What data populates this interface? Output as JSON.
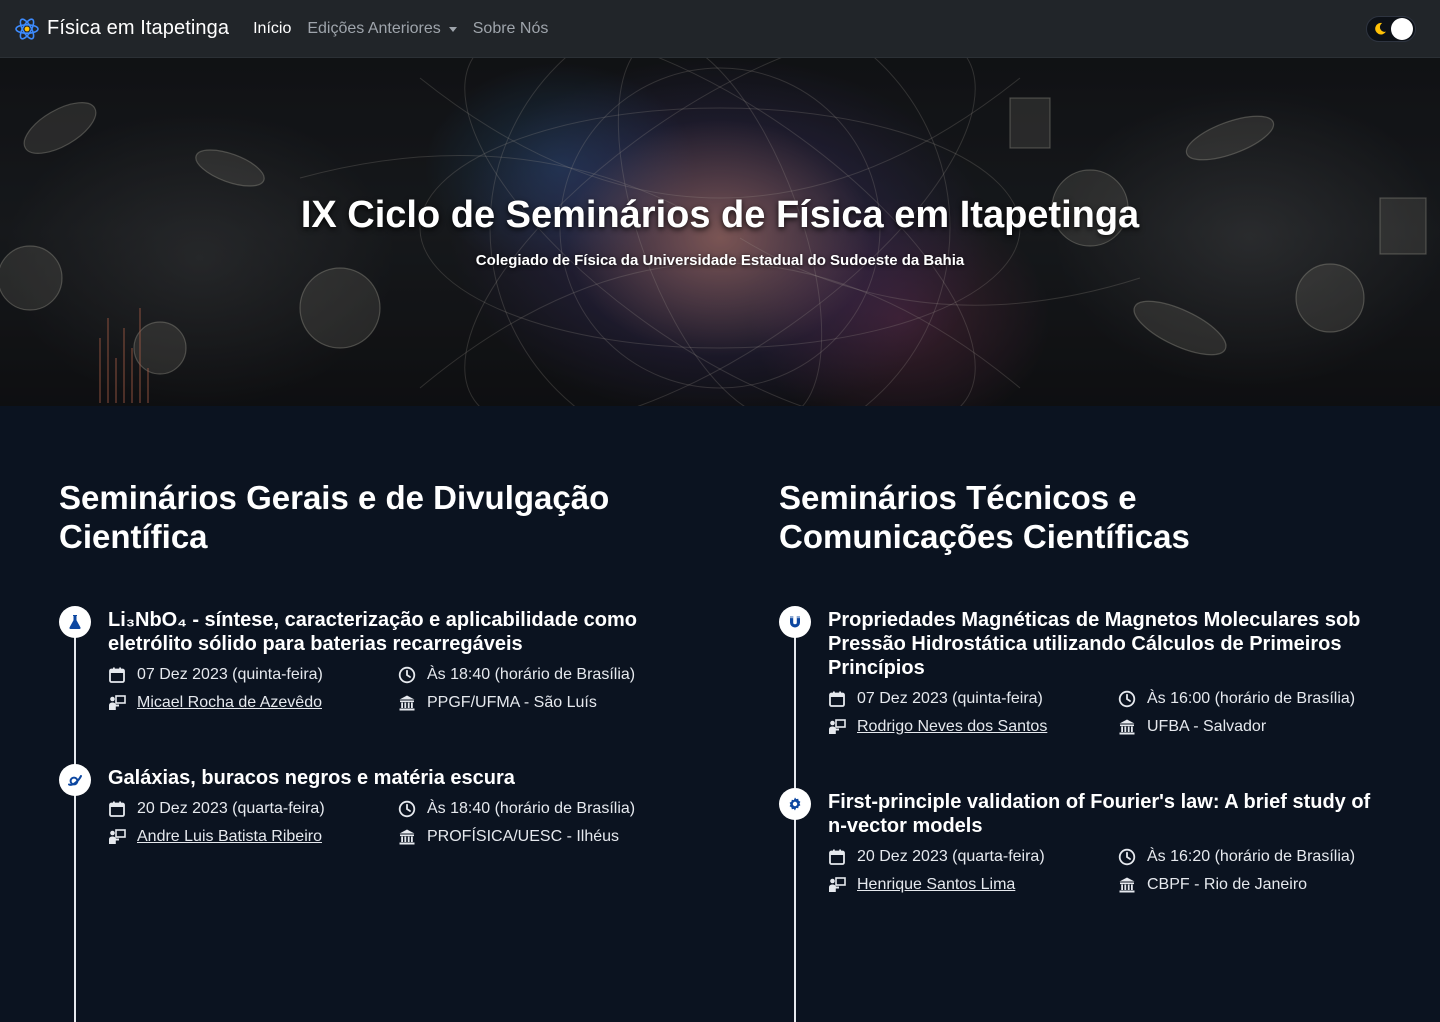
{
  "navbar": {
    "brand": "Física em Itapetinga",
    "links": [
      "Início",
      "Edições Anteriores",
      "Sobre Nós"
    ]
  },
  "hero": {
    "title": "IX Ciclo de Seminários de Física em Itapetinga",
    "subtitle": "Colegiado de Física da Universidade Estadual do Sudoeste da Bahia"
  },
  "general": {
    "heading": "Seminários Gerais e de Divulgação Científica",
    "items": [
      {
        "icon": "flask-icon",
        "title": "Li₃NbO₄ - síntese, caracterização e aplicabilidade como eletrólito sólido para baterias recarregáveis",
        "date": "07 Dez 2023 (quinta-feira)",
        "time": "Às 18:40 (horário de Brasília)",
        "speaker": "Micael Rocha de Azevêdo",
        "institution": "PPGF/UFMA - São Luís"
      },
      {
        "icon": "galaxy-icon",
        "title": "Galáxias, buracos negros e matéria escura",
        "date": "20 Dez 2023 (quarta-feira)",
        "time": "Às 18:40 (horário de Brasília)",
        "speaker": "Andre Luis Batista Ribeiro",
        "institution": "PROFÍSICA/UESC - Ilhéus"
      }
    ]
  },
  "technical": {
    "heading": "Seminários Técnicos e Comunicações Científicas",
    "items": [
      {
        "icon": "magnet-icon",
        "title": "Propriedades Magnéticas de Magnetos Moleculares sob Pressão Hidrostática utilizando Cálculos de Primeiros Princípios",
        "date": "07 Dez 2023 (quinta-feira)",
        "time": "Às 16:00 (horário de Brasília)",
        "speaker": "Rodrigo Neves dos Santos",
        "institution": "UFBA - Salvador"
      },
      {
        "icon": "gear-icon",
        "title": "First-principle validation of Fourier's law: A brief study of n-vector models",
        "date": "20 Dez 2023 (quarta-feira)",
        "time": "Às 16:20 (horário de Brasília)",
        "speaker": "Henrique Santos Lima",
        "institution": "CBPF - Rio de Janeiro"
      }
    ]
  },
  "colors": {
    "navbar_bg": "#212529",
    "page_bg": "#0b1320",
    "marker_icon": "#0d47a1"
  }
}
